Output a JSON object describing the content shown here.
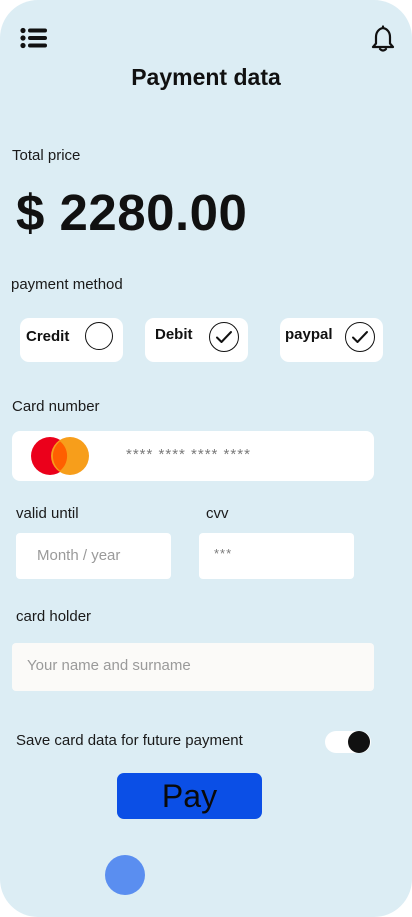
{
  "header": {
    "title": "Payment data",
    "menu_icon": "list-menu-icon",
    "notification_icon": "bell-icon"
  },
  "summary": {
    "total_label": "Total price",
    "total_value": "$ 2280.00"
  },
  "payment_method": {
    "label": "payment method",
    "options": [
      {
        "label": "Credit",
        "checked": false
      },
      {
        "label": "Debit",
        "checked": true
      },
      {
        "label": "paypal",
        "checked": true
      }
    ]
  },
  "card": {
    "number_label": "Card number",
    "number_mask": "**** **** **** ****",
    "brand_icon": "mastercard-logo-icon",
    "valid_label": "valid until",
    "valid_placeholder": "Month / year",
    "cvv_label": "cvv",
    "cvv_mask": "***",
    "holder_label": "card holder",
    "holder_placeholder": "Your name and surname"
  },
  "save": {
    "label": "Save card data for future payment",
    "enabled": true
  },
  "actions": {
    "pay_label": "Pay"
  },
  "colors": {
    "background": "#dcedf4",
    "pay_button": "#0b4fe6",
    "home_indicator": "#5a8ef0",
    "mastercard_red": "#eb001b",
    "mastercard_orange": "#f79e1b"
  }
}
